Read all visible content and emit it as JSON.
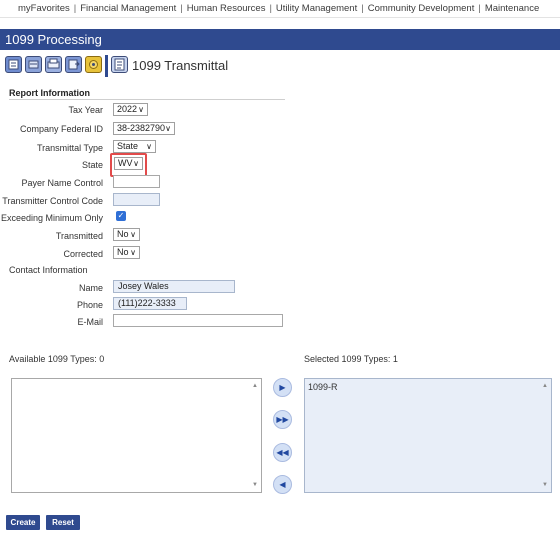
{
  "nav": {
    "items": [
      "myFavorites",
      "Financial Management",
      "Human Resources",
      "Utility Management",
      "Community Development",
      "Maintenance"
    ]
  },
  "page": {
    "title": "1099 Processing",
    "toolbar_title": "1099 Transmittal"
  },
  "report": {
    "heading": "Report Information",
    "tax_year": {
      "label": "Tax Year",
      "value": "2022"
    },
    "company_federal_id": {
      "label": "Company Federal ID",
      "value": "38-2382790"
    },
    "transmittal_type": {
      "label": "Transmittal Type",
      "value": "State"
    },
    "state": {
      "label": "State",
      "value": "WV"
    },
    "payer_name_control": {
      "label": "Payer Name Control",
      "value": ""
    },
    "transmitter_control_code": {
      "label": "Transmitter Control Code",
      "value": ""
    },
    "exceeding_minimum_only": {
      "label": "Exceeding Minimum Only",
      "checked": true
    },
    "transmitted": {
      "label": "Transmitted",
      "value": "No"
    },
    "corrected": {
      "label": "Corrected",
      "value": "No"
    }
  },
  "contact": {
    "heading": "Contact Information",
    "name": {
      "label": "Name",
      "value": "Josey Wales"
    },
    "phone": {
      "label": "Phone",
      "value": "(111)222-3333"
    },
    "email": {
      "label": "E-Mail",
      "value": ""
    }
  },
  "types": {
    "available_label": "Available 1099 Types: 0",
    "selected_label": "Selected 1099 Types: 1",
    "available_items": [],
    "selected_items": [
      "1099-R"
    ]
  },
  "actions": {
    "create_label": "Create",
    "reset_label": "Reset"
  },
  "colors": {
    "brand": "#2f4a8f",
    "highlight": "#e24b4b",
    "checkbox": "#2f6fd6"
  }
}
